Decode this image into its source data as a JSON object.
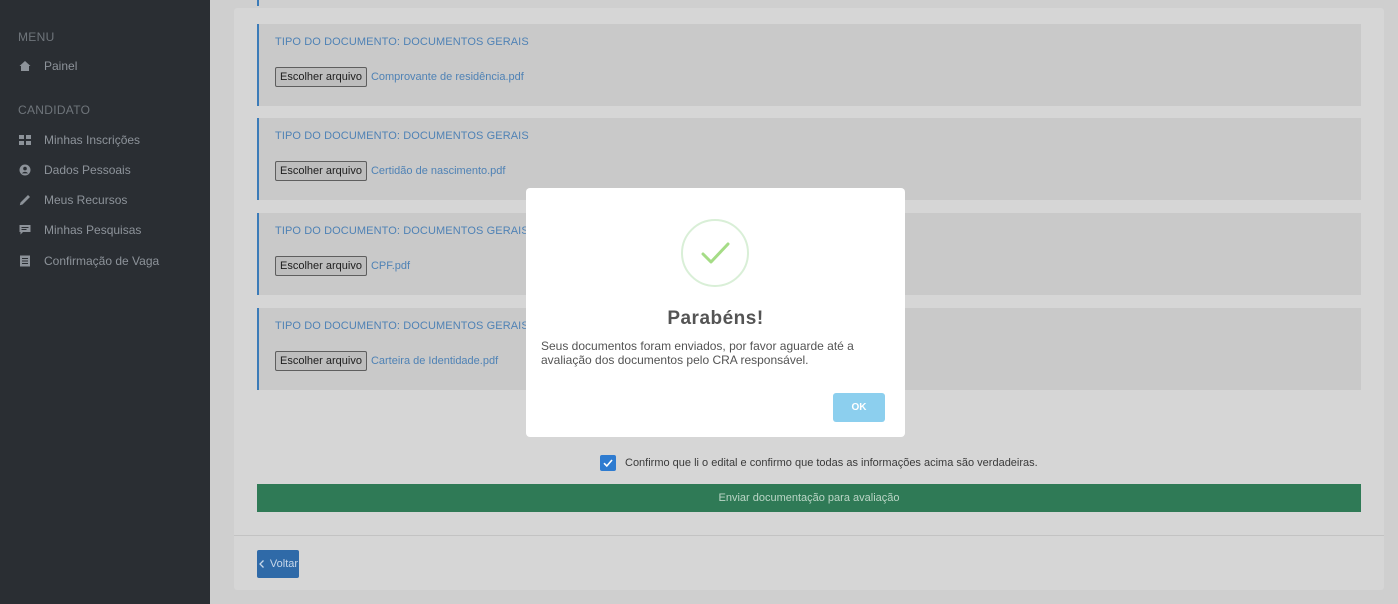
{
  "sidebar": {
    "menu_heading": "MENU",
    "painel_label": "Painel",
    "candidato_heading": "CANDIDATO",
    "items": [
      {
        "label": "Minhas Inscrições",
        "icon": "grid-icon"
      },
      {
        "label": "Dados Pessoais",
        "icon": "user-circle-icon"
      },
      {
        "label": "Meus Recursos",
        "icon": "pencil-icon"
      },
      {
        "label": "Minhas Pesquisas",
        "icon": "chat-icon"
      },
      {
        "label": "Confirmação de Vaga",
        "icon": "document-icon"
      }
    ]
  },
  "documents": [
    {
      "type_label": "TIPO DO DOCUMENTO: DOCUMENTOS GERAIS",
      "button_label": "Escolher arquivo",
      "file_name": "Comprovante de residência.pdf"
    },
    {
      "type_label": "TIPO DO DOCUMENTO: DOCUMENTOS GERAIS",
      "button_label": "Escolher arquivo",
      "file_name": "Certidão de nascimento.pdf"
    },
    {
      "type_label": "TIPO DO DOCUMENTO: DOCUMENTOS GERAIS",
      "button_label": "Escolher arquivo",
      "file_name": "CPF.pdf"
    },
    {
      "type_label": "TIPO DO DOCUMENTO: DOCUMENTOS GERAIS",
      "button_label": "Escolher arquivo",
      "file_name": "Carteira de Identidade.pdf"
    }
  ],
  "confirm": {
    "text": "Confirmo que li o edital e confirmo que todas as informações acima são verdadeiras.",
    "checked": true
  },
  "send_button_label": "Enviar documentação para avaliação",
  "back_button_label": "Voltar",
  "modal": {
    "title": "Parabéns!",
    "line1": "Seus documentos foram enviados, por favor aguarde até a",
    "line2": "avaliação dos documentos pelo CRA responsável.",
    "ok_label": "OK"
  },
  "colors": {
    "sidebar_bg": "#2a2e33",
    "accent_blue": "#4f82b5",
    "send_green": "#2f7a56",
    "ok_blue": "#8ccfee",
    "success_green": "#a5dc86"
  }
}
